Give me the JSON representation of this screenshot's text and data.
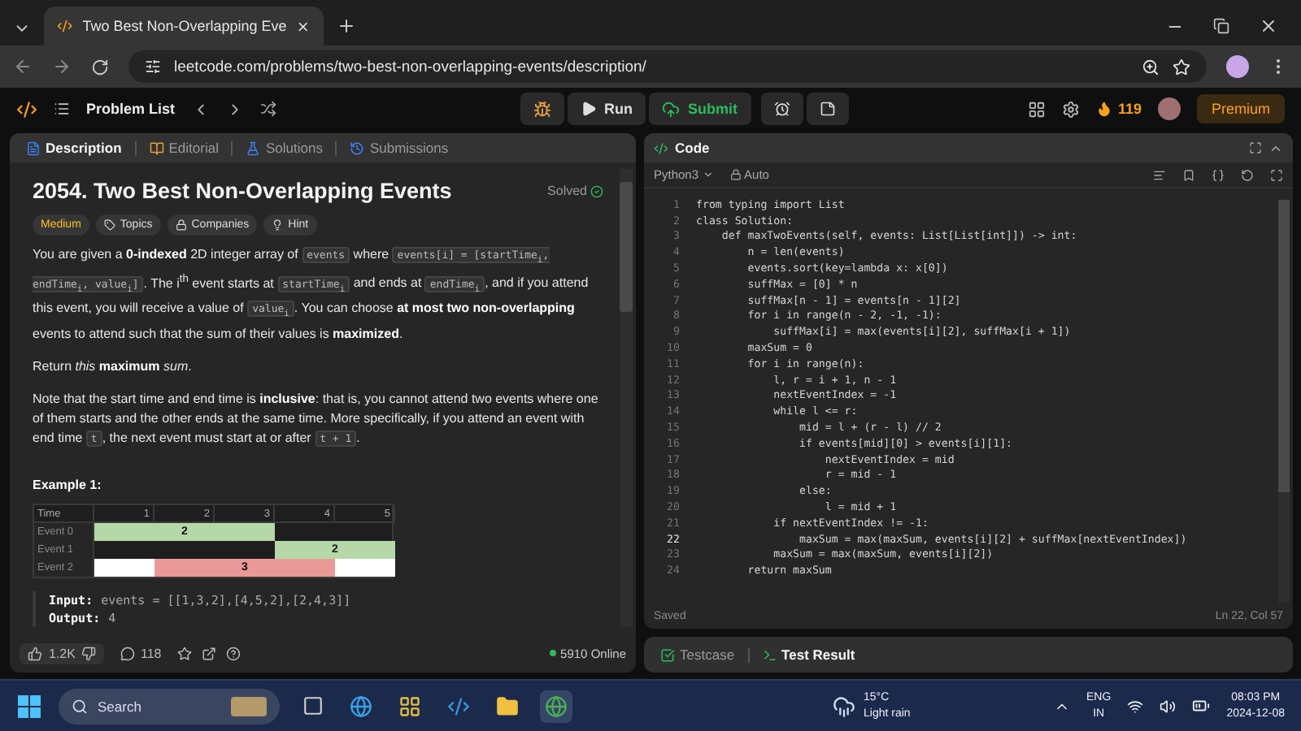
{
  "browser": {
    "tab_title": "Two Best Non-Overlapping Eve",
    "url": "leetcode.com/problems/two-best-non-overlapping-events/description/"
  },
  "nav": {
    "problem_list": "Problem List",
    "run": "Run",
    "submit": "Submit",
    "streak": "119",
    "premium": "Premium"
  },
  "left_tabs": [
    {
      "label": "Description",
      "selected": true,
      "kind": "description"
    },
    {
      "label": "Editorial",
      "selected": false,
      "kind": "editorial"
    },
    {
      "label": "Solutions",
      "selected": false,
      "kind": "solutions"
    },
    {
      "label": "Submissions",
      "selected": false,
      "kind": "submissions"
    }
  ],
  "problem": {
    "title": "2054. Two Best Non-Overlapping Events",
    "status": "Solved",
    "tags": [
      {
        "label": "Medium",
        "kind": "difficulty"
      },
      {
        "label": "Topics",
        "kind": "topics"
      },
      {
        "label": "Companies",
        "kind": "companies"
      },
      {
        "label": "Hint",
        "kind": "hint"
      }
    ],
    "paragraphs": [
      [
        {
          "kind": "text",
          "text": "You are given a **0-indexed** 2D integer array of "
        },
        {
          "kind": "code",
          "text": "events"
        },
        {
          "kind": "text",
          "text": " where "
        },
        {
          "kind": "code",
          "text": "events[i] = [startTime$_{i}$, endTime$_{i}$, value$_{i}$]"
        },
        {
          "kind": "text",
          "text": ". The i$^{th}$ event starts at "
        },
        {
          "kind": "code",
          "text": "startTime$_{i}$"
        },
        {
          "kind": "text",
          "text": " and ends at "
        },
        {
          "kind": "code",
          "text": "endTime$_{i}$"
        },
        {
          "kind": "text",
          "text": ", and if you attend this event, you will receive a value of "
        },
        {
          "kind": "code",
          "text": "value$_{i}$"
        },
        {
          "kind": "text",
          "text": ". You can choose **at most two non-overlapping** events to attend such that the sum of their values is **maximized**."
        }
      ],
      [
        {
          "kind": "text",
          "text": "Return *this* **maximum** *sum*."
        }
      ],
      [
        {
          "kind": "text",
          "text": "Note that the start time and end time is **inclusive**: that is, you cannot attend two events where one of them starts and the other ends at the same time. More specifically, if you attend an event with end time "
        },
        {
          "kind": "code",
          "text": "t"
        },
        {
          "kind": "text",
          "text": ", the next event must start at or after "
        },
        {
          "kind": "code",
          "text": "t + 1"
        },
        {
          "kind": "text",
          "text": "."
        }
      ]
    ],
    "example": {
      "heading": "Example 1:",
      "timeline": {
        "header": [
          "Time",
          "1",
          "2",
          "3",
          "4",
          "5"
        ],
        "rows": [
          {
            "label": "Event 0",
            "cells": [
              {
                "color": "#b6d7a8",
                "label": "2"
              },
              {
                "color": "#b6d7a8"
              },
              {
                "color": "#b6d7a8"
              },
              {},
              {}
            ]
          },
          {
            "label": "Event 1",
            "cells": [
              {},
              {},
              {},
              {
                "color": "#b6d7a8",
                "label": "2"
              },
              {
                "color": "#b6d7a8"
              }
            ]
          },
          {
            "label": "Event 2",
            "cells": [
              {
                "color": "#ffffff"
              },
              {
                "color": "#ea9999",
                "label": "3"
              },
              {
                "color": "#ea9999"
              },
              {
                "color": "#ea9999"
              },
              {
                "color": "#ffffff"
              }
            ]
          }
        ]
      },
      "input_label": "Input:",
      "input": "events = [[1,3,2],[4,5,2],[2,4,3]]",
      "output_label": "Output:",
      "output": "4"
    }
  },
  "footer": {
    "likes": "1.2K",
    "comments": "118",
    "online": "5910 Online"
  },
  "code_panel": {
    "title": "Code",
    "language": "Python3",
    "mode": "Auto",
    "status": "Saved",
    "cursor": "Ln 22, Col 57",
    "lines": [
      {
        "number": "1",
        "code": "from typing import List",
        "current": false
      },
      {
        "number": "2",
        "code": "class Solution:",
        "current": false
      },
      {
        "number": "3",
        "code": "    def maxTwoEvents(self, events: List[List[int]]) -> int:",
        "current": false
      },
      {
        "number": "4",
        "code": "        n = len(events)",
        "current": false
      },
      {
        "number": "5",
        "code": "        events.sort(key=lambda x: x[0])",
        "current": false
      },
      {
        "number": "6",
        "code": "        suffMax = [0] * n",
        "current": false
      },
      {
        "number": "7",
        "code": "        suffMax[n - 1] = events[n - 1][2]",
        "current": false
      },
      {
        "number": "8",
        "code": "        for i in range(n - 2, -1, -1):",
        "current": false
      },
      {
        "number": "9",
        "code": "            suffMax[i] = max(events[i][2], suffMax[i + 1])",
        "current": false
      },
      {
        "number": "10",
        "code": "        maxSum = 0",
        "current": false
      },
      {
        "number": "11",
        "code": "        for i in range(n):",
        "current": false
      },
      {
        "number": "12",
        "code": "            l, r = i + 1, n - 1",
        "current": false
      },
      {
        "number": "13",
        "code": "            nextEventIndex = -1",
        "current": false
      },
      {
        "number": "14",
        "code": "            while l <= r:",
        "current": false
      },
      {
        "number": "15",
        "code": "                mid = l + (r - l) // 2",
        "current": false
      },
      {
        "number": "16",
        "code": "                if events[mid][0] > events[i][1]:",
        "current": false
      },
      {
        "number": "17",
        "code": "                    nextEventIndex = mid",
        "current": false
      },
      {
        "number": "18",
        "code": "                    r = mid - 1",
        "current": false
      },
      {
        "number": "19",
        "code": "                else:",
        "current": false
      },
      {
        "number": "20",
        "code": "                    l = mid + 1",
        "current": false
      },
      {
        "number": "21",
        "code": "            if nextEventIndex != -1:",
        "current": false
      },
      {
        "number": "22",
        "code": "                maxSum = max(maxSum, events[i][2] + suffMax[nextEventIndex])",
        "current": true
      },
      {
        "number": "23",
        "code": "            maxSum = max(maxSum, events[i][2])",
        "current": false
      },
      {
        "number": "24",
        "code": "        return maxSum",
        "current": false
      }
    ]
  },
  "bottom_tabs": [
    {
      "label": "Testcase",
      "selected": false,
      "kind": "testcase"
    },
    {
      "label": "Test Result",
      "selected": true,
      "kind": "result"
    }
  ],
  "taskbar": {
    "search": "Search",
    "temperature": "15°C",
    "weather": "Light rain",
    "language": "ENG",
    "region": "IN",
    "time": "08:03 PM",
    "date": "2024-12-08"
  }
}
